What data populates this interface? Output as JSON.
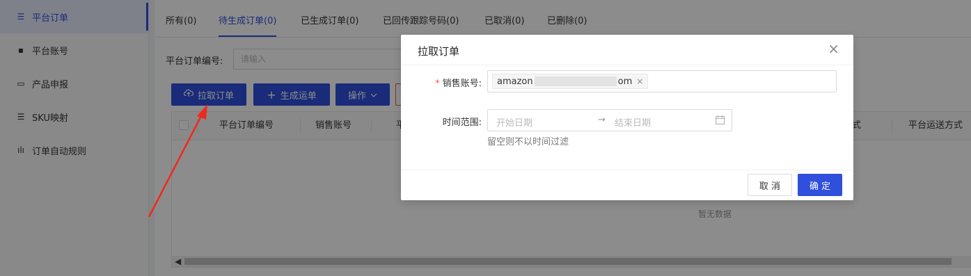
{
  "sidebar": {
    "items": [
      {
        "label": "平台订单",
        "icon": "list-icon",
        "glyph": "☰",
        "active": true
      },
      {
        "label": "平台账号",
        "icon": "card-icon",
        "glyph": "▪",
        "active": false
      },
      {
        "label": "产品申报",
        "icon": "monitor-icon",
        "glyph": "▭",
        "active": false
      },
      {
        "label": "SKU映射",
        "icon": "list-icon",
        "glyph": "☰",
        "active": false
      },
      {
        "label": "订单自动规则",
        "icon": "bar-chart-icon",
        "glyph": "ılı",
        "active": false
      }
    ]
  },
  "tabs": [
    {
      "label": "所有(0)"
    },
    {
      "label": "待生成订单(0)"
    },
    {
      "label": "已生成订单(0)"
    },
    {
      "label": "已回传跟踪号码(0)"
    },
    {
      "label": "已取消(0)"
    },
    {
      "label": "已删除(0)"
    }
  ],
  "filter": {
    "label": "平台订单编号:",
    "placeholder": "请输入"
  },
  "toolbar": {
    "pull_label": "拉取订单",
    "generate_label": "生成运单",
    "actions_label": "操作"
  },
  "table": {
    "headers": [
      "平台订单编号",
      "销售账号",
      "平",
      "式",
      "平台运送方式"
    ],
    "empty_text": "暂无数据"
  },
  "modal": {
    "title": "拉取订单",
    "account_label": "销售账号:",
    "account_tag_prefix": "amazon",
    "account_tag_suffix": "om",
    "time_label": "时间范围:",
    "start_placeholder": "开始日期",
    "end_placeholder": "结束日期",
    "arrow": "→",
    "hint": "留空则不以时间过滤",
    "cancel_label": "取 消",
    "ok_label": "确 定",
    "close_glyph": "×"
  },
  "colors": {
    "primary": "#2f4fdc",
    "required": "#ff4d4f",
    "annotation_arrow": "#f0281e"
  }
}
